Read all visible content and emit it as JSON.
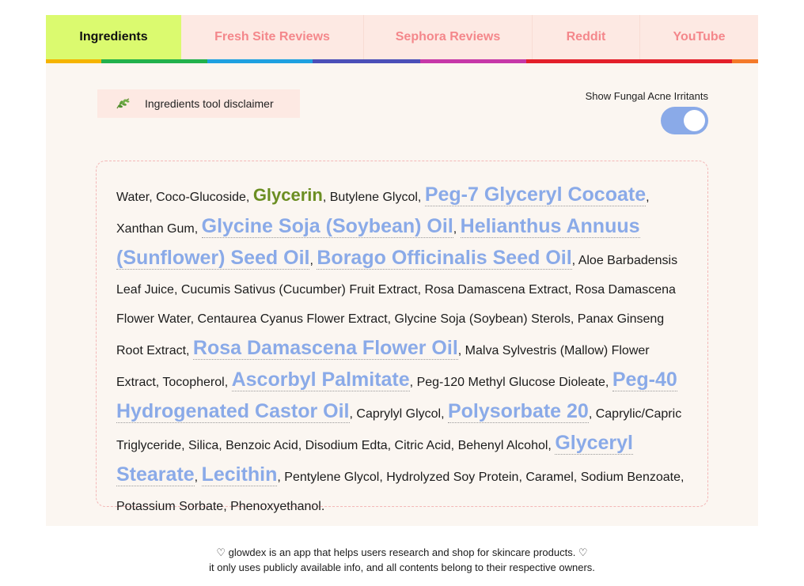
{
  "tabs": [
    {
      "label": "Ingredients",
      "active": true
    },
    {
      "label": "Fresh Site Reviews",
      "active": false
    },
    {
      "label": "Sephora Reviews",
      "active": false
    },
    {
      "label": "Reddit",
      "active": false
    },
    {
      "label": "YouTube",
      "active": false
    }
  ],
  "tab_bar_colors": [
    "#f5b400",
    "#22b14c",
    "#1ea0e0",
    "#4b4fb8",
    "#c638a8",
    "#e3202a",
    "#f47a2a"
  ],
  "disclaimer": {
    "icon": "leaf-icon",
    "label": "Ingredients tool disclaimer"
  },
  "toggle": {
    "label": "Show Fungal Acne Irritants",
    "on": true,
    "color": "#8aaae8"
  },
  "ingredients": [
    {
      "name": "Water",
      "type": "plain"
    },
    {
      "name": "Coco-Glucoside",
      "type": "plain"
    },
    {
      "name": "Glycerin",
      "type": "good"
    },
    {
      "name": "Butylene Glycol",
      "type": "plain"
    },
    {
      "name": "Peg-7 Glyceryl Cocoate",
      "type": "irritant"
    },
    {
      "name": "Xanthan Gum",
      "type": "plain"
    },
    {
      "name": "Glycine Soja (Soybean) Oil",
      "type": "irritant"
    },
    {
      "name": "Helianthus Annuus (Sunflower) Seed Oil",
      "type": "irritant"
    },
    {
      "name": "Borago Officinalis Seed Oil",
      "type": "irritant"
    },
    {
      "name": "Aloe Barbadensis Leaf Juice",
      "type": "plain"
    },
    {
      "name": "Cucumis Sativus (Cucumber) Fruit Extract",
      "type": "plain"
    },
    {
      "name": "Rosa Damascena Extract",
      "type": "plain"
    },
    {
      "name": "Rosa Damascena Flower Water",
      "type": "plain"
    },
    {
      "name": "Centaurea Cyanus Flower Extract",
      "type": "plain"
    },
    {
      "name": "Glycine Soja (Soybean) Sterols",
      "type": "plain"
    },
    {
      "name": "Panax Ginseng Root Extract",
      "type": "plain"
    },
    {
      "name": "Rosa Damascena Flower Oil",
      "type": "irritant"
    },
    {
      "name": "Malva Sylvestris (Mallow) Flower Extract",
      "type": "plain"
    },
    {
      "name": "Tocopherol",
      "type": "plain"
    },
    {
      "name": "Ascorbyl Palmitate",
      "type": "irritant"
    },
    {
      "name": "Peg-120 Methyl Glucose Dioleate",
      "type": "plain"
    },
    {
      "name": "Peg-40 Hydrogenated Castor Oil",
      "type": "irritant"
    },
    {
      "name": "Caprylyl Glycol",
      "type": "plain"
    },
    {
      "name": "Polysorbate 20",
      "type": "irritant"
    },
    {
      "name": "Caprylic/Capric Triglyceride",
      "type": "plain"
    },
    {
      "name": "Silica",
      "type": "plain"
    },
    {
      "name": "Benzoic Acid",
      "type": "plain"
    },
    {
      "name": "Disodium Edta",
      "type": "plain"
    },
    {
      "name": "Citric Acid",
      "type": "plain"
    },
    {
      "name": "Behenyl Alcohol",
      "type": "plain"
    },
    {
      "name": "Glyceryl Stearate",
      "type": "irritant"
    },
    {
      "name": "Lecithin",
      "type": "irritant"
    },
    {
      "name": "Pentylene Glycol",
      "type": "plain"
    },
    {
      "name": "Hydrolyzed Soy Protein",
      "type": "plain"
    },
    {
      "name": "Caramel",
      "type": "plain"
    },
    {
      "name": "Sodium Benzoate",
      "type": "plain"
    },
    {
      "name": "Potassium Sorbate",
      "type": "plain"
    },
    {
      "name": "Phenoxyethanol",
      "type": "plain"
    }
  ],
  "footer": {
    "line1": "♡ glowdex is an app that helps users research and shop for skincare products. ♡",
    "line2": "it only uses publicly available info, and all contents belong to their respective owners."
  }
}
